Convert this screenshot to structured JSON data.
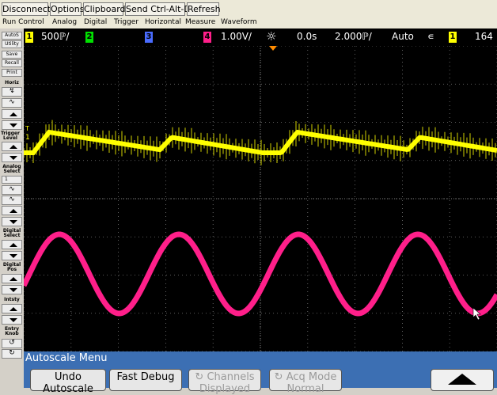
{
  "toolbar": {
    "disconnect": "Disconnect",
    "options": "Options",
    "clipboard": "Clipboard",
    "ctrl_alt_del": "Send Ctrl-Alt-Del",
    "refresh": "Refresh"
  },
  "menus": [
    "Run Control",
    "Analog",
    "Digital",
    "Trigger",
    "Horizontal",
    "Measure",
    "Waveform"
  ],
  "sidebar": {
    "autoscale": "AutoS",
    "utility": "Utility",
    "save": "Save",
    "recall": "Recall",
    "print": "Print",
    "horiz": "Horiz",
    "trigger_level": "Trigger Level",
    "analog_select": "Analog Select",
    "analog_select_value": "1",
    "digital_select": "Digital Select",
    "digital_pos": "Digital Pos",
    "intensity": "Intsty",
    "entry_knob": "Entry Knob"
  },
  "status": {
    "ch1_num": "1",
    "ch1_scale": "500ℙ/",
    "ch2_num": "2",
    "ch3_num": "3",
    "ch4_num": "4",
    "ch4_scale": "1.00V/",
    "delay": "0.0s",
    "timebase": "2.000ℙ/",
    "mode": "Auto",
    "trig_src": "1",
    "trig_level": "164"
  },
  "markers": {
    "ch1": "1",
    "ch4": "4",
    "trigger": "T"
  },
  "softmenu": {
    "title": "Autoscale Menu",
    "undo": "Undo",
    "undo_line2": "Autoscale",
    "fast_debug": "Fast Debug",
    "channels": "Channels",
    "channels_line2": "Displayed",
    "acq_mode": "Acq Mode",
    "acq_mode_line2": "Normal"
  },
  "colors": {
    "ch1": "#ffff00",
    "ch2": "#00e000",
    "ch3": "#4a6cff",
    "ch4": "#ff1f8a",
    "grid": "#7a7a7a",
    "menu_bar": "#3c6fb3"
  },
  "icons": {
    "intensity_icon": "sun-icon",
    "trigger_slope_icon": "rising-edge-icon",
    "cursor": "mouse-pointer-icon"
  }
}
